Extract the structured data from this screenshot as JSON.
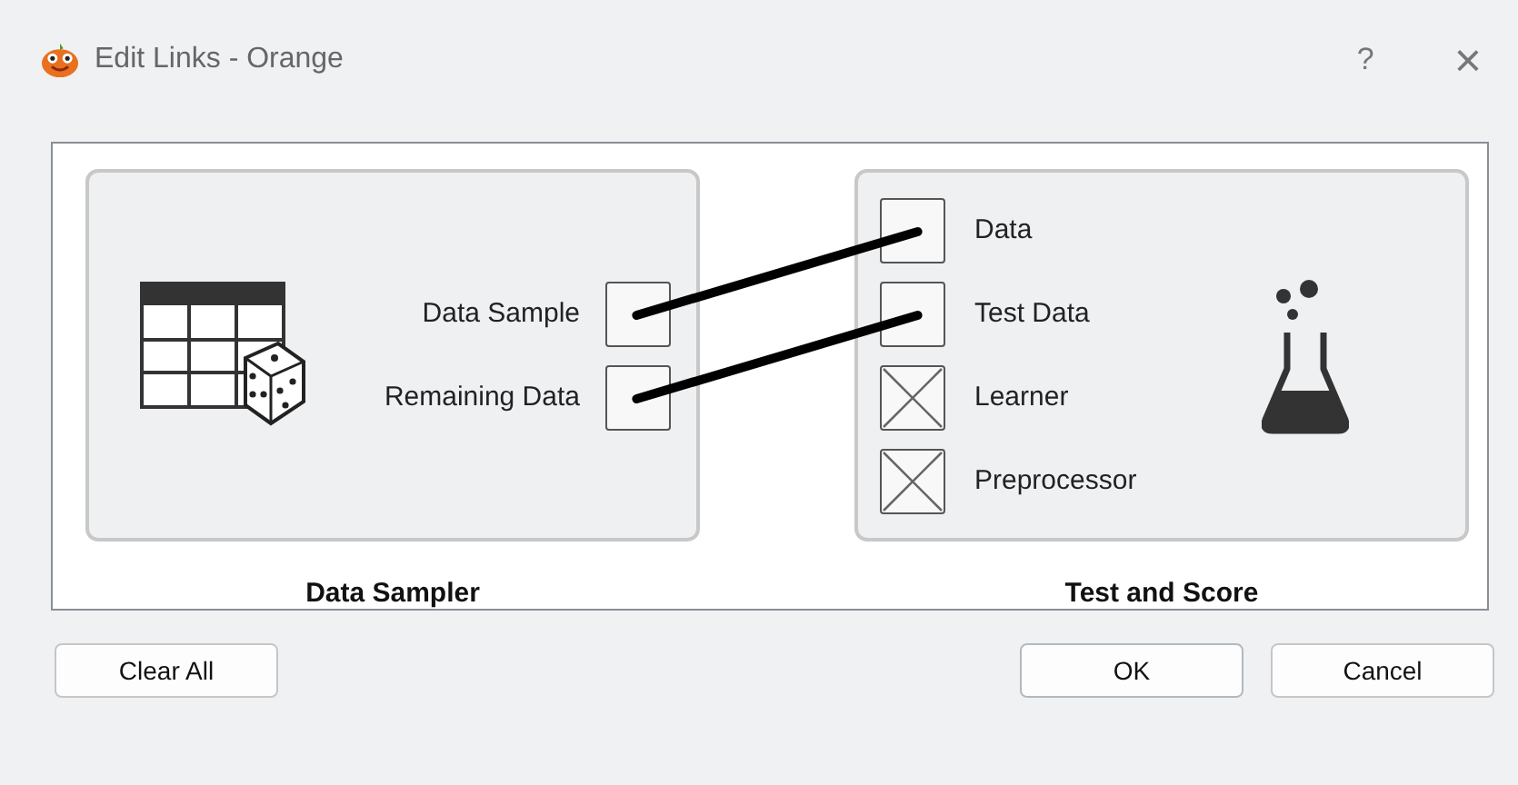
{
  "window": {
    "title": "Edit Links - Orange",
    "help": "?",
    "close": "×"
  },
  "source": {
    "title": "Data Sampler",
    "outputs": [
      {
        "name": "Data Sample",
        "linked": true
      },
      {
        "name": "Remaining Data",
        "linked": true
      }
    ]
  },
  "sink": {
    "title": "Test and Score",
    "inputs": [
      {
        "name": "Data",
        "linked": true,
        "disabled": false
      },
      {
        "name": "Test Data",
        "linked": true,
        "disabled": false
      },
      {
        "name": "Learner",
        "linked": false,
        "disabled": true
      },
      {
        "name": "Preprocessor",
        "linked": false,
        "disabled": true
      }
    ]
  },
  "buttons": {
    "left": [
      "Clear All"
    ],
    "right": [
      "OK",
      "Cancel"
    ]
  }
}
